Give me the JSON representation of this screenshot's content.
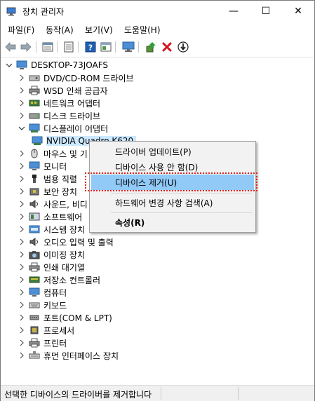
{
  "window": {
    "title": "장치 관리자",
    "minimize": "—",
    "maximize": "☐",
    "close": "✕"
  },
  "menu": [
    "파일(F)",
    "동작(A)",
    "보기(V)",
    "도움말(H)"
  ],
  "tree": {
    "root": "DESKTOP-73JOAFS",
    "items": [
      "DVD/CD-ROM 드라이브",
      "WSD 인쇄 공급자",
      "네트워크 어댑터",
      "디스크 드라이브",
      "디스플레이 어댑터",
      "NVIDIA Quadro K620",
      "마우스 및 기",
      "모니터",
      "범용 직렬",
      "보안 장치",
      "사운드, 비디",
      "소프트웨어",
      "시스템 장치",
      "오디오 입력 및 출력",
      "이미징 장치",
      "인쇄 대기열",
      "저장소 컨트롤러",
      "컴퓨터",
      "키보드",
      "포트(COM & LPT)",
      "프로세서",
      "프린터",
      "휴먼 인터페이스 장치"
    ]
  },
  "context_menu": [
    "드라이버 업데이트(P)",
    "디바이스 사용 안 함(D)",
    "디바이스 제거(U)",
    "하드웨어 변경 사항 검색(A)",
    "속성(R)"
  ],
  "status": "선택한 디바이스의 드라이버를 제거합니다"
}
